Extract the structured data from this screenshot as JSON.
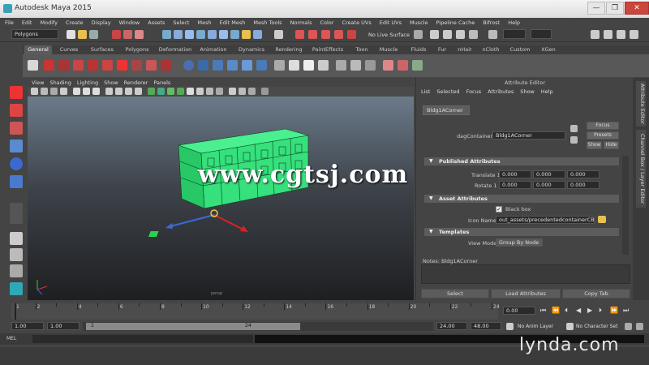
{
  "window": {
    "title": "Autodesk Maya 2015",
    "min_label": "—",
    "max_label": "❐",
    "close_label": "✕"
  },
  "menubar": [
    "File",
    "Edit",
    "Modify",
    "Create",
    "Display",
    "Window",
    "Assets",
    "Select",
    "Mesh",
    "Edit Mesh",
    "Mesh Tools",
    "Normals",
    "Color",
    "Create UVs",
    "Edit UVs",
    "Muscle",
    "Pipeline Cache",
    "Bifrost",
    "Help"
  ],
  "statusline": {
    "menuset": "Polygons",
    "live_surface": "No Live Surface"
  },
  "shelf": {
    "tabs": [
      "General",
      "Curves",
      "Surfaces",
      "Polygons",
      "Deformation",
      "Animation",
      "Dynamics",
      "Rendering",
      "PaintEffects",
      "Toon",
      "Muscle",
      "Fluids",
      "Fur",
      "nHair",
      "nCloth",
      "Custom",
      "XGen"
    ],
    "active": "General"
  },
  "viewport": {
    "menu": [
      "View",
      "Shading",
      "Lighting",
      "Show",
      "Renderer",
      "Panels"
    ],
    "camera_label": "persp"
  },
  "attribute_editor": {
    "title": "Attribute Editor",
    "menu": [
      "List",
      "Selected",
      "Focus",
      "Attributes",
      "Show",
      "Help"
    ],
    "node_tab": "Bldg1ACorner",
    "container_label": "dagContainer:",
    "container_value": "Bldg1ACorner",
    "focus_btn": "Focus",
    "presets_btn": "Presets",
    "show_btn": "Show",
    "hide_btn": "Hide",
    "sections": {
      "published": "Published Attributes",
      "asset": "Asset Attributes",
      "templates": "Templates"
    },
    "translate_label": "Translate 1",
    "rotate_label": "Rotate 1",
    "translate_values": [
      "0.000",
      "0.000",
      "0.000"
    ],
    "rotate_values": [
      "0.000",
      "0.000",
      "0.000"
    ],
    "blackbox_label": "Black box",
    "icon_name_label": "Icon Name",
    "icon_name_value": "out_assets/precedentedcontainerCB.type",
    "view_mode_label": "View Mode",
    "view_mode_value": "Group By Node",
    "notes_label": "Notes: Bldg1ACorner",
    "select_btn": "Select",
    "load_btn": "Load Attributes",
    "copy_btn": "Copy Tab"
  },
  "side_tabs": [
    "Attribute Editor",
    "Channel Box / Layer Editor"
  ],
  "timeline": {
    "ticks": [
      "1",
      "2",
      "4",
      "6",
      "8",
      "10",
      "12",
      "14",
      "16",
      "18",
      "20",
      "22",
      "24"
    ],
    "current_frame": "0.00"
  },
  "range": {
    "start": "1.00",
    "start2": "1.00",
    "current": "1",
    "end_inner": "24",
    "end": "24.00",
    "end2": "48.00",
    "anim_layer": "No Anim Layer",
    "char_set": "No Character Set"
  },
  "cmdline": {
    "label": "MEL"
  },
  "watermarks": {
    "lynda": "lynda.com",
    "cg": "www.cgtsj.com"
  }
}
